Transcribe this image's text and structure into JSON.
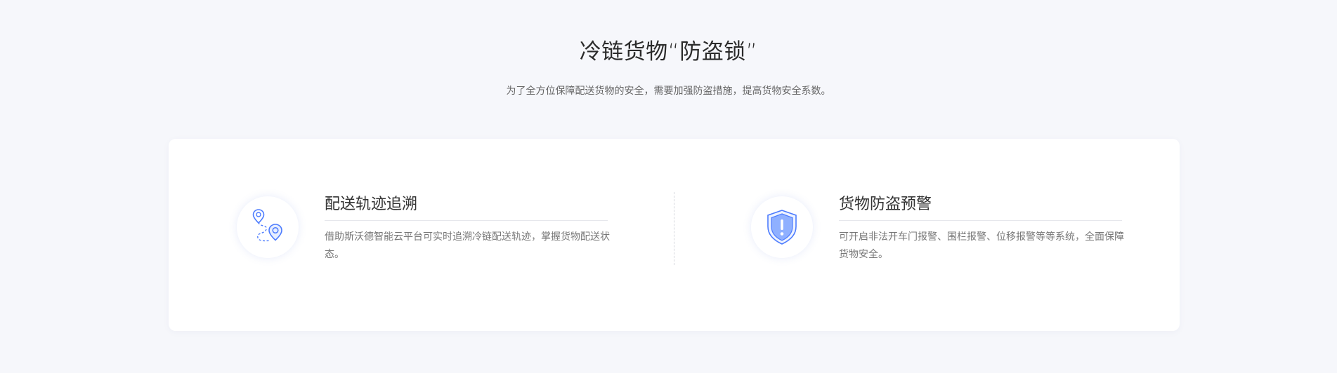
{
  "section": {
    "title": "冷链货物“防盗锁”",
    "subtitle": "为了全方位保障配送货物的安全，需要加强防盗措施，提高货物安全系数。"
  },
  "features": [
    {
      "icon": "route-pins-icon",
      "title": "配送轨迹追溯",
      "description": "借助斯沃德智能云平台可实时追溯冷链配送轨迹，掌握货物配送状态。"
    },
    {
      "icon": "shield-alert-icon",
      "title": "货物防盗预警",
      "description": "可开启非法开车门报警、围栏报警、位移报警等等系统，全面保障货物安全。"
    }
  ],
  "colors": {
    "background": "#f6f7fb",
    "card": "#ffffff",
    "accent": "#4d7cfe",
    "accent_light": "#9bb6ff"
  }
}
